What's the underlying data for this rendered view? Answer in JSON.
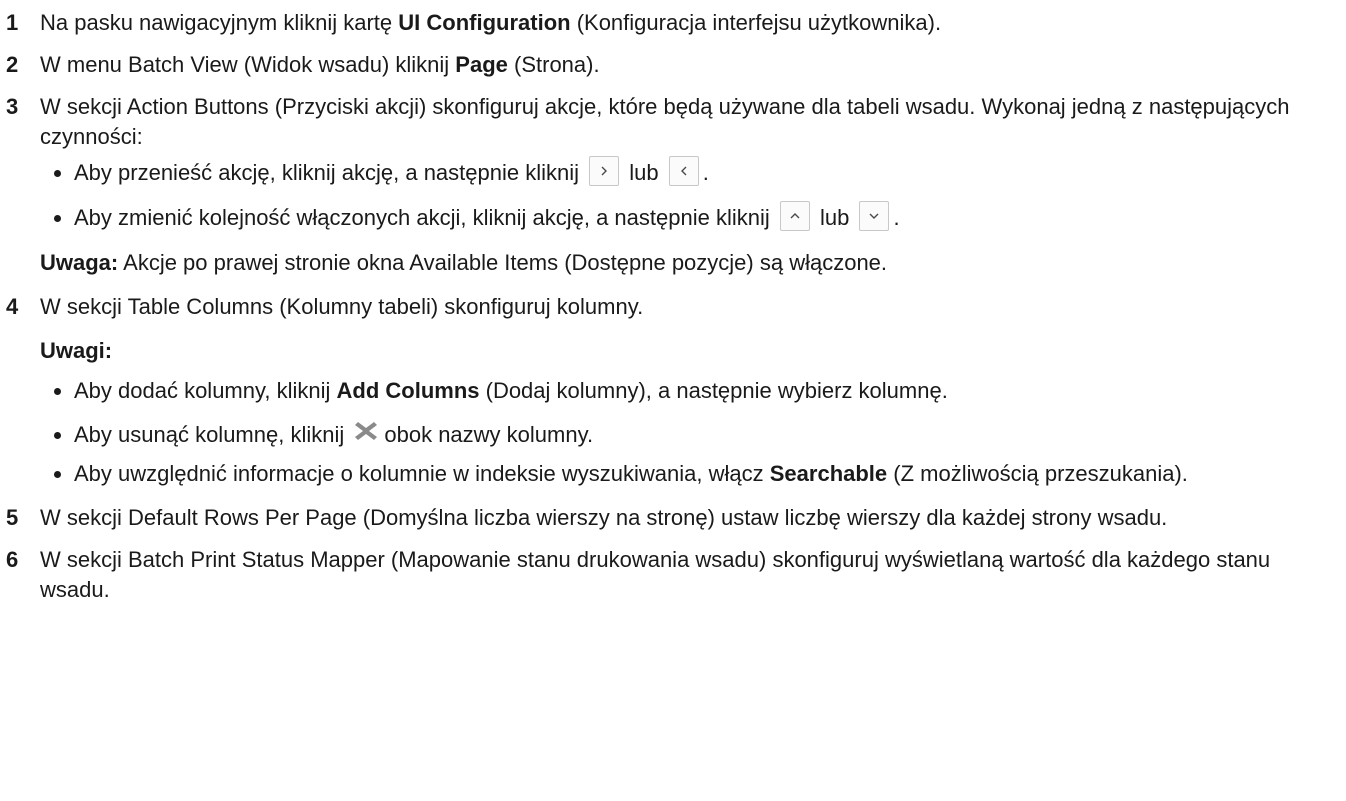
{
  "steps": [
    {
      "num": "1",
      "parts": [
        "Na pasku nawigacyjnym kliknij kartę ",
        "UI Configuration",
        " (Konfiguracja interfejsu użytkownika)."
      ]
    },
    {
      "num": "2",
      "parts": [
        "W menu Batch View (Widok wsadu) kliknij ",
        "Page",
        " (Strona)."
      ]
    },
    {
      "num": "3",
      "text": "W sekcji Action Buttons (Przyciski akcji) skonfiguruj akcje, które będą używane dla tabeli wsadu. Wykonaj jedną z następujących czynności:",
      "bullets": [
        {
          "before": "Aby przenieść akcję, kliknij akcję, a następnie kliknij",
          "icon1": "chevron-right-icon",
          "middle": "lub",
          "icon2": "chevron-left-icon",
          "after": "."
        },
        {
          "before": "Aby zmienić kolejność włączonych akcji, kliknij akcję, a następnie kliknij",
          "icon1": "chevron-up-icon",
          "middle": "lub",
          "icon2": "chevron-down-icon",
          "after": "."
        }
      ],
      "note_label": "Uwaga:",
      "note_text": " Akcje po prawej stronie okna Available Items (Dostępne pozycje) są włączone."
    },
    {
      "num": "4",
      "text": "W sekcji Table Columns (Kolumny tabeli) skonfiguruj kolumny.",
      "notes_label": "Uwagi:",
      "bullets": [
        {
          "parts": [
            "Aby dodać kolumny, kliknij ",
            "Add Columns",
            " (Dodaj kolumny), a następnie wybierz kolumnę."
          ]
        },
        {
          "before": "Aby usunąć kolumnę, kliknij",
          "icon": "close-x-icon",
          "after": "obok nazwy kolumny."
        },
        {
          "parts": [
            "Aby uwzględnić informacje o kolumnie w indeksie wyszukiwania, włącz ",
            "Searchable",
            " (Z możliwością przeszukania)."
          ]
        }
      ]
    },
    {
      "num": "5",
      "text": "W sekcji Default Rows Per Page (Domyślna liczba wierszy na stronę) ustaw liczbę wierszy dla każdej strony wsadu."
    },
    {
      "num": "6",
      "text": "W sekcji Batch Print Status Mapper (Mapowanie stanu drukowania wsadu) skonfiguruj wyświetlaną wartość dla każdego stanu wsadu."
    }
  ],
  "colors": {
    "text": "#1a1a1a",
    "icon_border": "#c8c8c8",
    "icon_glyph": "#4a4a4a",
    "x_icon": "#8a8a8a"
  }
}
